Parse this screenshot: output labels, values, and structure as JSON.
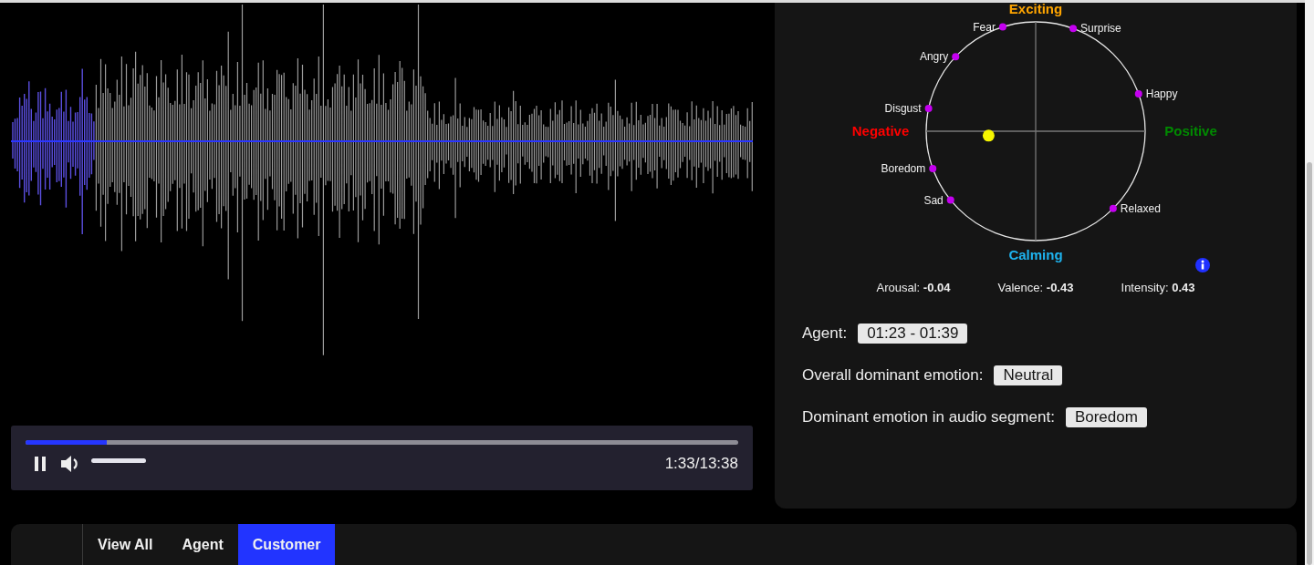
{
  "player": {
    "progress": {
      "level": 0.114
    },
    "volume": {
      "level": 1.0
    },
    "time": "1:33/13:38"
  },
  "emotion_wheel": {
    "axes": [
      {
        "label": "Exciting",
        "color": "#ffa500"
      },
      {
        "label": "Calming",
        "color": "#1eb4f0"
      },
      {
        "label": "Negative",
        "color": "#ff0000"
      },
      {
        "label": "Positive",
        "color": "#008a00"
      }
    ],
    "emotions": [
      "Fear",
      "Surprise",
      "Angry",
      "Happy",
      "Disgust",
      "Boredom",
      "Sad",
      "Relaxed"
    ],
    "stats": [
      {
        "label": "Arousal:",
        "value": "-0.04"
      },
      {
        "label": "Valence:",
        "value": "-0.43"
      },
      {
        "label": "Intensity:",
        "value": "0.43"
      }
    ]
  },
  "details": [
    {
      "label": "Agent:",
      "value": "01:23 - 01:39"
    },
    {
      "label": "Overall dominant emotion:",
      "value": "Neutral"
    },
    {
      "label": "Dominant emotion in audio segment:",
      "value": "Boredom"
    }
  ],
  "tabs": [
    {
      "label": "View All",
      "selected": false
    },
    {
      "label": "Agent",
      "selected": false
    },
    {
      "label": "Customer",
      "selected": true
    }
  ]
}
